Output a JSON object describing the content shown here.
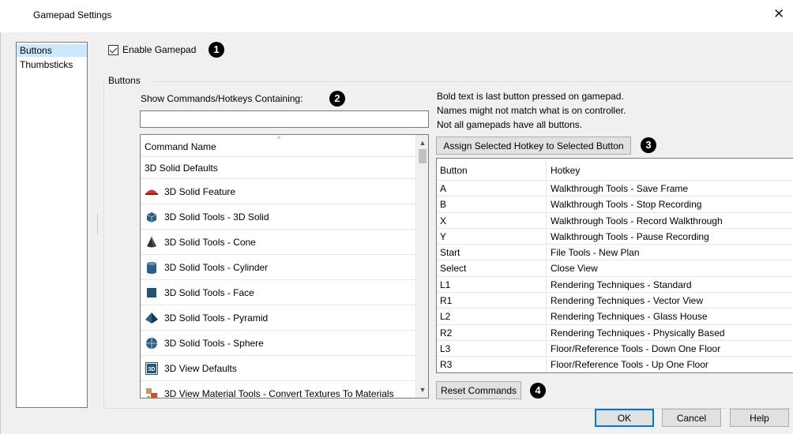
{
  "window": {
    "title": "Gamepad Settings",
    "close_glyph": "✕"
  },
  "sidebar": {
    "items": [
      {
        "label": "Buttons",
        "selected": true
      },
      {
        "label": "Thumbsticks",
        "selected": false
      }
    ]
  },
  "enable_gamepad": {
    "label": "Enable Gamepad",
    "checked": true
  },
  "callouts": [
    "1",
    "2",
    "3",
    "4"
  ],
  "buttons_group": {
    "label": "Buttons"
  },
  "filter": {
    "label": "Show Commands/Hotkeys Containing:",
    "value": "",
    "placeholder": ""
  },
  "command_list": {
    "header": "Command Name",
    "sort_indicator": "^",
    "rows": [
      {
        "label": "3D Solid Defaults",
        "icon": ""
      },
      {
        "label": "3D Solid Feature",
        "icon": "solid-feature-icon"
      },
      {
        "label": "3D Solid Tools - 3D Solid",
        "icon": "solid-cube-icon"
      },
      {
        "label": "3D Solid Tools - Cone",
        "icon": "cone-icon"
      },
      {
        "label": "3D Solid Tools - Cylinder",
        "icon": "cylinder-icon"
      },
      {
        "label": "3D Solid Tools - Face",
        "icon": "face-icon"
      },
      {
        "label": "3D Solid Tools - Pyramid",
        "icon": "pyramid-icon"
      },
      {
        "label": "3D Solid Tools - Sphere",
        "icon": "sphere-icon"
      },
      {
        "label": "3D View Defaults",
        "icon": "3d-view-defaults-icon"
      },
      {
        "label": "3D View Material Tools - Convert Textures To Materials",
        "icon": "convert-textures-icon"
      }
    ]
  },
  "info_text": [
    "Bold text is last button pressed on gamepad.",
    "Names might not match what is on controller.",
    "Not all gamepads have all buttons."
  ],
  "assign_button": {
    "label": "Assign Selected Hotkey to Selected Button"
  },
  "hotkey_table": {
    "columns": [
      "Button",
      "Hotkey"
    ],
    "rows": [
      {
        "button": "A",
        "hotkey": "Walkthrough Tools - Save Frame"
      },
      {
        "button": "B",
        "hotkey": "Walkthrough Tools - Stop Recording"
      },
      {
        "button": "X",
        "hotkey": "Walkthrough Tools - Record Walkthrough"
      },
      {
        "button": "Y",
        "hotkey": "Walkthrough Tools - Pause Recording"
      },
      {
        "button": "Start",
        "hotkey": "File Tools - New Plan"
      },
      {
        "button": "Select",
        "hotkey": "Close View"
      },
      {
        "button": "L1",
        "hotkey": "Rendering Techniques - Standard"
      },
      {
        "button": "R1",
        "hotkey": "Rendering Techniques - Vector View"
      },
      {
        "button": "L2",
        "hotkey": "Rendering Techniques - Glass House"
      },
      {
        "button": "R2",
        "hotkey": "Rendering Techniques - Physically Based"
      },
      {
        "button": "L3",
        "hotkey": "Floor/Reference Tools - Down One Floor"
      },
      {
        "button": "R3",
        "hotkey": "Floor/Reference Tools - Up One Floor"
      }
    ]
  },
  "reset_button": {
    "label": "Reset Commands"
  },
  "footer": {
    "ok": "OK",
    "cancel": "Cancel",
    "help": "Help"
  },
  "colors": {
    "selection": "#cce8ff",
    "default_button_border": "#0078d7",
    "dialog_bg": "#f0f0f0"
  }
}
